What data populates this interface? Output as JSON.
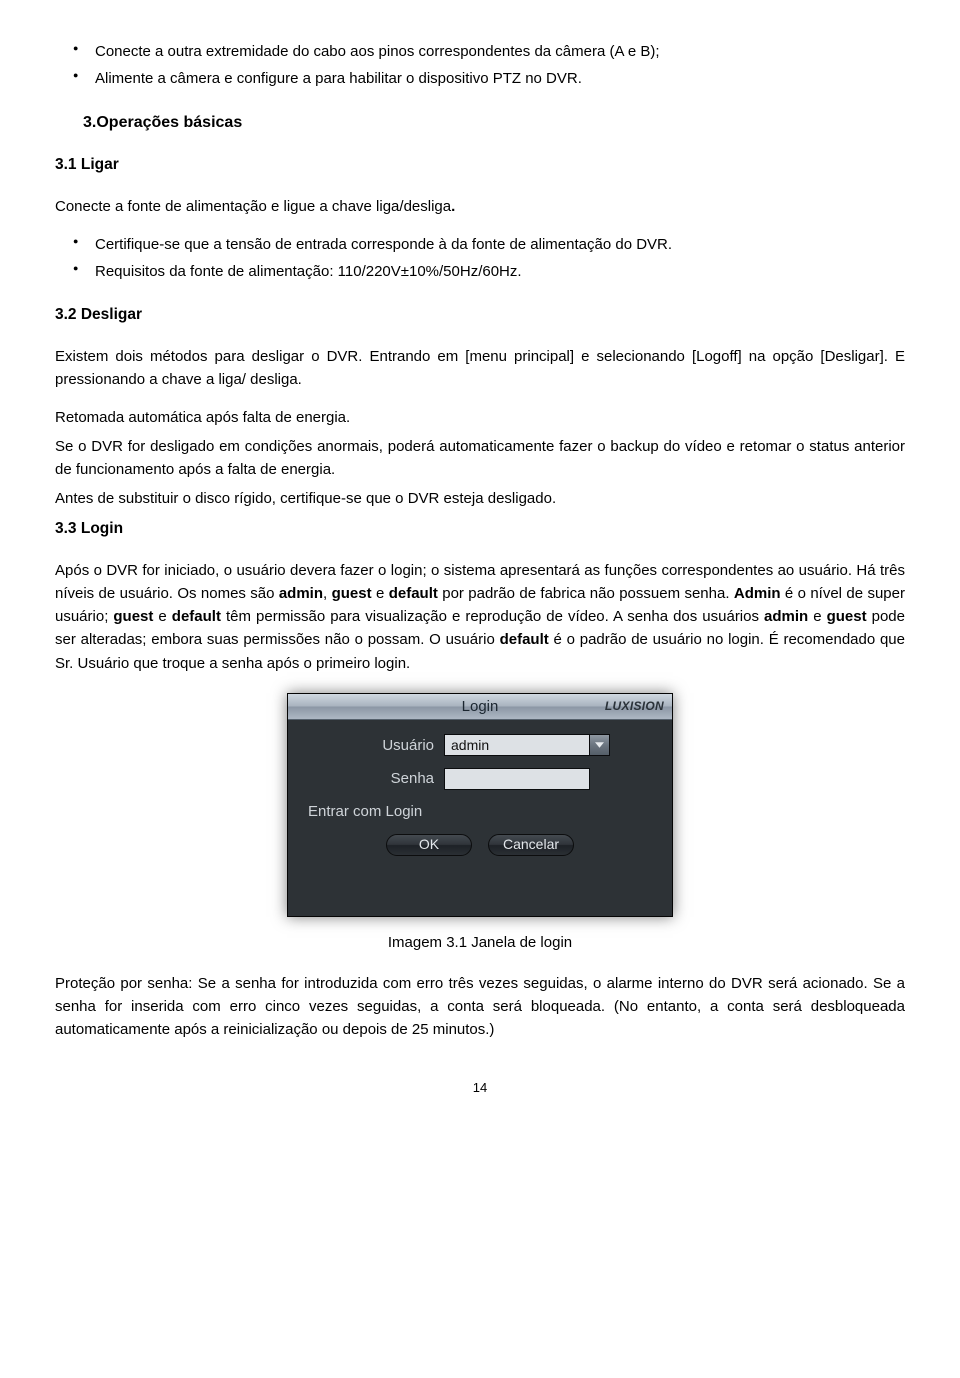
{
  "bullets_top": [
    "Conecte a outra extremidade do cabo aos pinos correspondentes da câmera (A e B);",
    "Alimente a câmera e configure a para habilitar o dispositivo PTZ no DVR."
  ],
  "sec3": {
    "heading": "3.Operações básicas"
  },
  "sec31": {
    "heading": "3.1 Ligar",
    "intro_pre": "Conecte a fonte de alimentação e ligue a chave liga/desliga",
    "intro_post": ".",
    "bullets": [
      "Certifique-se que a tensão de entrada corresponde à da fonte de alimentação do DVR.",
      "Requisitos da fonte de alimentação: 110/220V±10%/50Hz/60Hz."
    ]
  },
  "sec32": {
    "heading": "3.2 Desligar",
    "p1": "Existem dois métodos para desligar o DVR. Entrando em [menu principal] e selecionando [Logoff] na opção [Desligar]. E pressionando a chave a liga/ desliga.",
    "resume_title": "Retomada automática após falta de energia.",
    "resume_body": "Se o DVR for desligado em condições anormais, poderá automaticamente fazer o backup do vídeo e retomar o status anterior de funcionamento após a falta de energia.",
    "hdd_note": "Antes de substituir o disco rígido, certifique-se que o DVR esteja desligado."
  },
  "sec33": {
    "heading": "3.3 Login",
    "p1_parts": [
      "Após o DVR for iniciado, o usuário devera fazer o login; o sistema apresentará as funções correspondentes ao usuário. Há três níveis de usuário. Os nomes são ",
      "admin",
      ", ",
      "guest",
      " e ",
      "default",
      " por padrão de fabrica não possuem senha. ",
      "Admin",
      " é o nível de super usuário; ",
      "guest",
      " e ",
      "default",
      " têm permissão para visualização e reprodução de vídeo. A senha dos usuários ",
      "admin",
      " e ",
      "guest",
      " pode ser alteradas; embora suas permissões não o possam. O usuário ",
      "default",
      " é o padrão de usuário no login. É recomendado que Sr. Usuário que troque a senha após o primeiro login."
    ]
  },
  "login": {
    "title": "Login",
    "brand": "LUXISION",
    "user_label": "Usuário",
    "user_value": "admin",
    "pass_label": "Senha",
    "pass_value": "",
    "extra_label": "Entrar com Login",
    "ok": "OK",
    "cancel": "Cancelar"
  },
  "figure_caption": "Imagem 3.1 Janela de login",
  "pw_protect": "Proteção por senha: Se a senha for introduzida com erro três vezes seguidas, o alarme interno do DVR será acionado. Se a senha for inserida com erro cinco vezes seguidas, a conta será bloqueada. (No entanto, a conta será desbloqueada automaticamente após a reinicialização ou depois de 25 minutos.)",
  "page_number": "14"
}
